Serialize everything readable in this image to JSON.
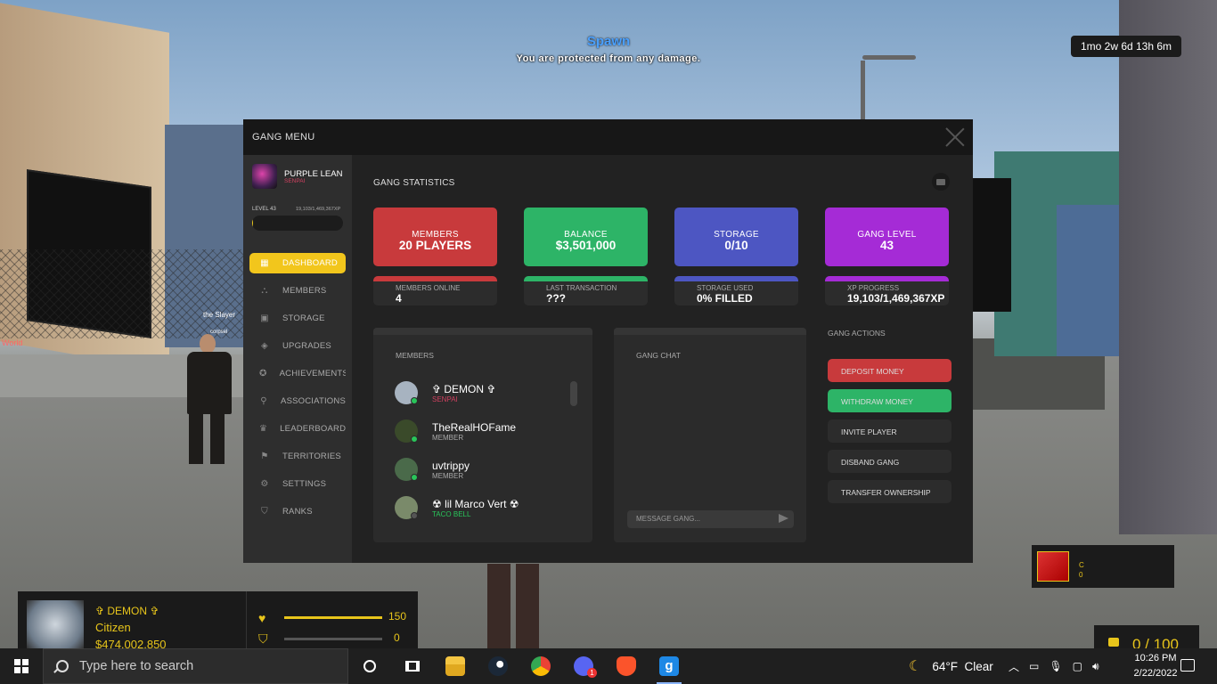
{
  "hud_top": {
    "zone_title": "Spawn",
    "zone_message": "You are protected from any damage.",
    "timer": "1mo 2w 6d 13h 6m"
  },
  "scene_labels": {
    "world": "World",
    "player_tag": "the Slayer",
    "player_sub": "corpsel"
  },
  "gang_menu": {
    "title": "GANG MENU",
    "gang_name": "PURPLE LEAN",
    "gang_rank": "SENPAI",
    "level_label": "LEVEL 43",
    "level_xp": "19,103/1,469,367XP",
    "level_progress": 0.013,
    "nav": [
      {
        "label": "DASHBOARD",
        "icon": "dashboard-icon",
        "glyph": "▦",
        "active": true
      },
      {
        "label": "MEMBERS",
        "icon": "members-icon",
        "glyph": "⛬",
        "active": false
      },
      {
        "label": "STORAGE",
        "icon": "storage-icon",
        "glyph": "▣",
        "active": false
      },
      {
        "label": "UPGRADES",
        "icon": "upgrades-icon",
        "glyph": "◈",
        "active": false
      },
      {
        "label": "ACHIEVEMENTS",
        "icon": "achievements-icon",
        "glyph": "✪",
        "active": false
      },
      {
        "label": "ASSOCIATIONS",
        "icon": "associations-icon",
        "glyph": "⚲",
        "active": false
      },
      {
        "label": "LEADERBOARD",
        "icon": "leaderboard-icon",
        "glyph": "♛",
        "active": false
      },
      {
        "label": "TERRITORIES",
        "icon": "territories-icon",
        "glyph": "⚑",
        "active": false
      },
      {
        "label": "SETTINGS",
        "icon": "settings-icon",
        "glyph": "⚙",
        "active": false
      },
      {
        "label": "RANKS",
        "icon": "ranks-icon",
        "glyph": "⛉",
        "active": false
      }
    ],
    "stats_title": "GANG STATISTICS",
    "stats": [
      {
        "label": "MEMBERS",
        "value": "20 PLAYERS",
        "color": "#c83a3c",
        "sub_label": "MEMBERS ONLINE",
        "sub_value": "4"
      },
      {
        "label": "BALANCE",
        "value": "$3,501,000",
        "color": "#2db467",
        "sub_label": "LAST TRANSACTION",
        "sub_value": "???"
      },
      {
        "label": "STORAGE",
        "value": "0/10",
        "color": "#4d56c2",
        "sub_label": "STORAGE USED",
        "sub_value": "0% FILLED"
      },
      {
        "label": "GANG LEVEL",
        "value": "43",
        "color": "#a52bd6",
        "sub_label": "XP PROGRESS",
        "sub_value": "19,103/1,469,367XP"
      }
    ],
    "members_title": "MEMBERS",
    "members": [
      {
        "name": "✞ DEMON ✞",
        "rank": "SENPAI",
        "rank_color": "#d04060",
        "online": true,
        "avatar_color": "#a7b3c0"
      },
      {
        "name": "TheRealHOFame",
        "rank": "MEMBER",
        "rank_color": "#aaaaaa",
        "online": true,
        "avatar_color": "#3a4a2a"
      },
      {
        "name": "uvtrippy",
        "rank": "MEMBER",
        "rank_color": "#aaaaaa",
        "online": true,
        "avatar_color": "#4a6a4a"
      },
      {
        "name": "☢ lil Marco Vert ☢",
        "rank": "TACO BELL",
        "rank_color": "#29c55a",
        "online": false,
        "avatar_color": "#7a8a6a"
      }
    ],
    "chat_title": "GANG CHAT",
    "chat_placeholder": "MESSAGE GANG...",
    "actions_title": "GANG ACTIONS",
    "actions": [
      {
        "label": "DEPOSIT MONEY",
        "color": "#c83a3c"
      },
      {
        "label": "WITHDRAW MONEY",
        "color": "#2db467"
      },
      {
        "label": "INVITE PLAYER",
        "color": "#2c2c2c"
      },
      {
        "label": "DISBAND GANG",
        "color": "#2c2c2c"
      },
      {
        "label": "TRANSFER OWNERSHIP",
        "color": "#2c2c2c"
      }
    ]
  },
  "player_hud": {
    "name": "✞ DEMON ✞",
    "job": "Citizen",
    "money": "$474,002,850",
    "health": "150",
    "armor": "0"
  },
  "weapon_hud": {
    "line1": "C",
    "line2": "0"
  },
  "ammo_hud": {
    "text": "0 / 100"
  },
  "taskbar": {
    "search_placeholder": "Type here to search",
    "weather_temp": "64°F",
    "weather_desc": "Clear",
    "time": "10:26 PM",
    "date": "2/22/2022",
    "discord_badge": "1",
    "gmod_letter": "g"
  }
}
